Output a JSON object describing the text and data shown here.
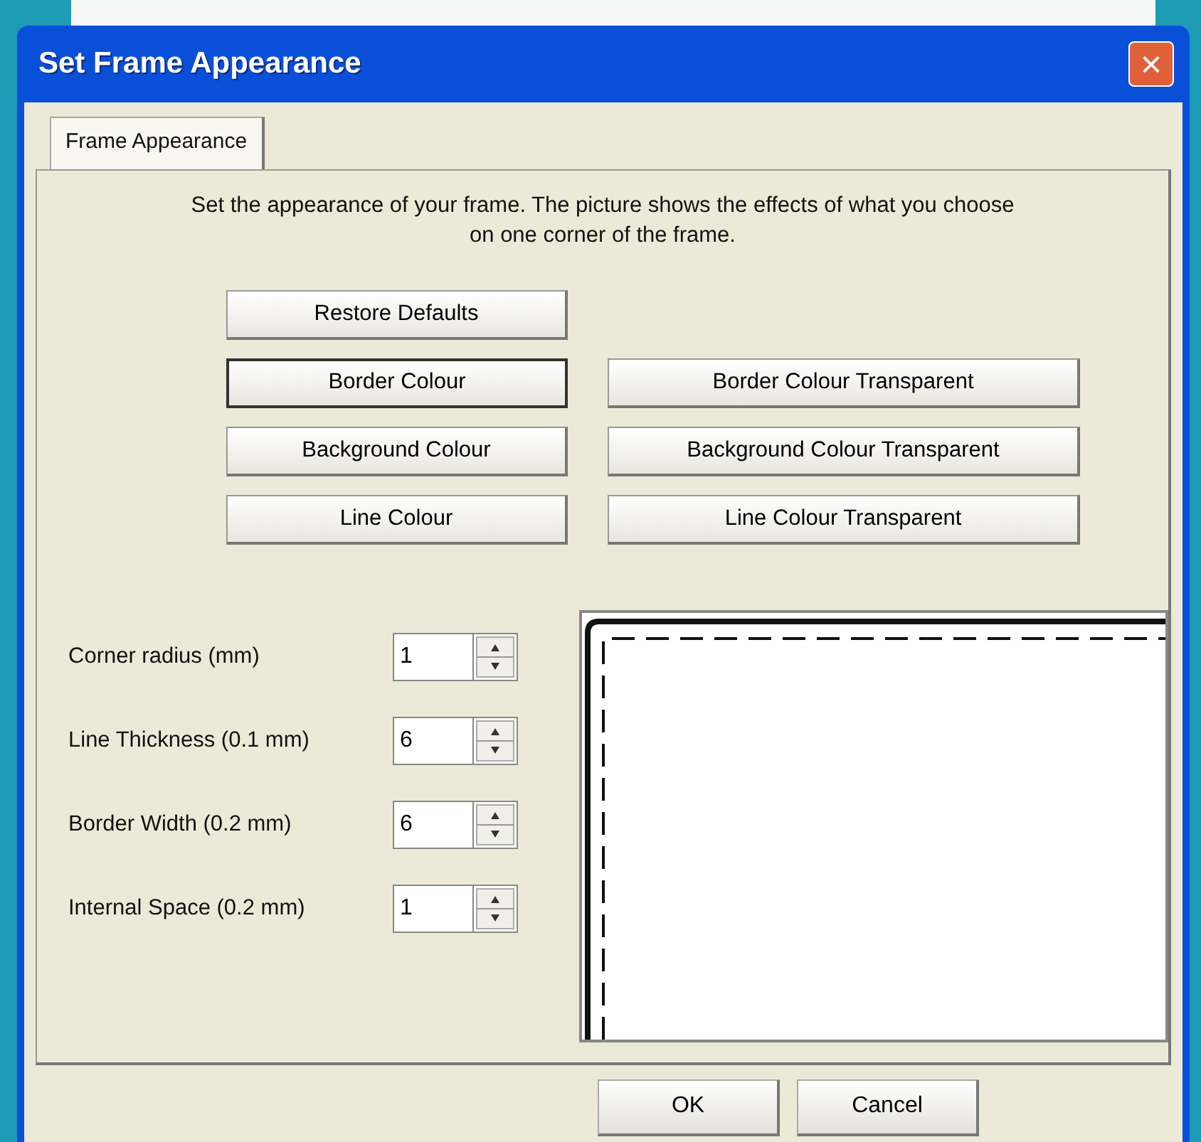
{
  "window": {
    "title": "Set Frame Appearance",
    "close_icon": "×"
  },
  "tabs": [
    {
      "label": "Frame Appearance",
      "selected": true
    }
  ],
  "description": "Set the appearance of your frame. The picture shows the effects of what you choose on one corner of the frame.",
  "button_rows": [
    [
      {
        "label": "Restore Defaults",
        "focused": false
      }
    ],
    [
      {
        "label": "Border Colour",
        "focused": true
      },
      {
        "label": "Border Colour Transparent",
        "focused": false
      }
    ],
    [
      {
        "label": "Background Colour",
        "focused": false
      },
      {
        "label": "Background Colour Transparent",
        "focused": false
      }
    ],
    [
      {
        "label": "Line Colour",
        "focused": false
      },
      {
        "label": "Line Colour Transparent",
        "focused": false
      }
    ]
  ],
  "fields": [
    {
      "label": "Corner radius (mm)",
      "value": "1"
    },
    {
      "label": "Line Thickness (0.1 mm)",
      "value": "6"
    },
    {
      "label": "Border Width (0.2 mm)",
      "value": "6"
    },
    {
      "label": "Internal Space (0.2 mm)",
      "value": "1"
    }
  ],
  "dialog_buttons": [
    "OK",
    "Cancel"
  ]
}
